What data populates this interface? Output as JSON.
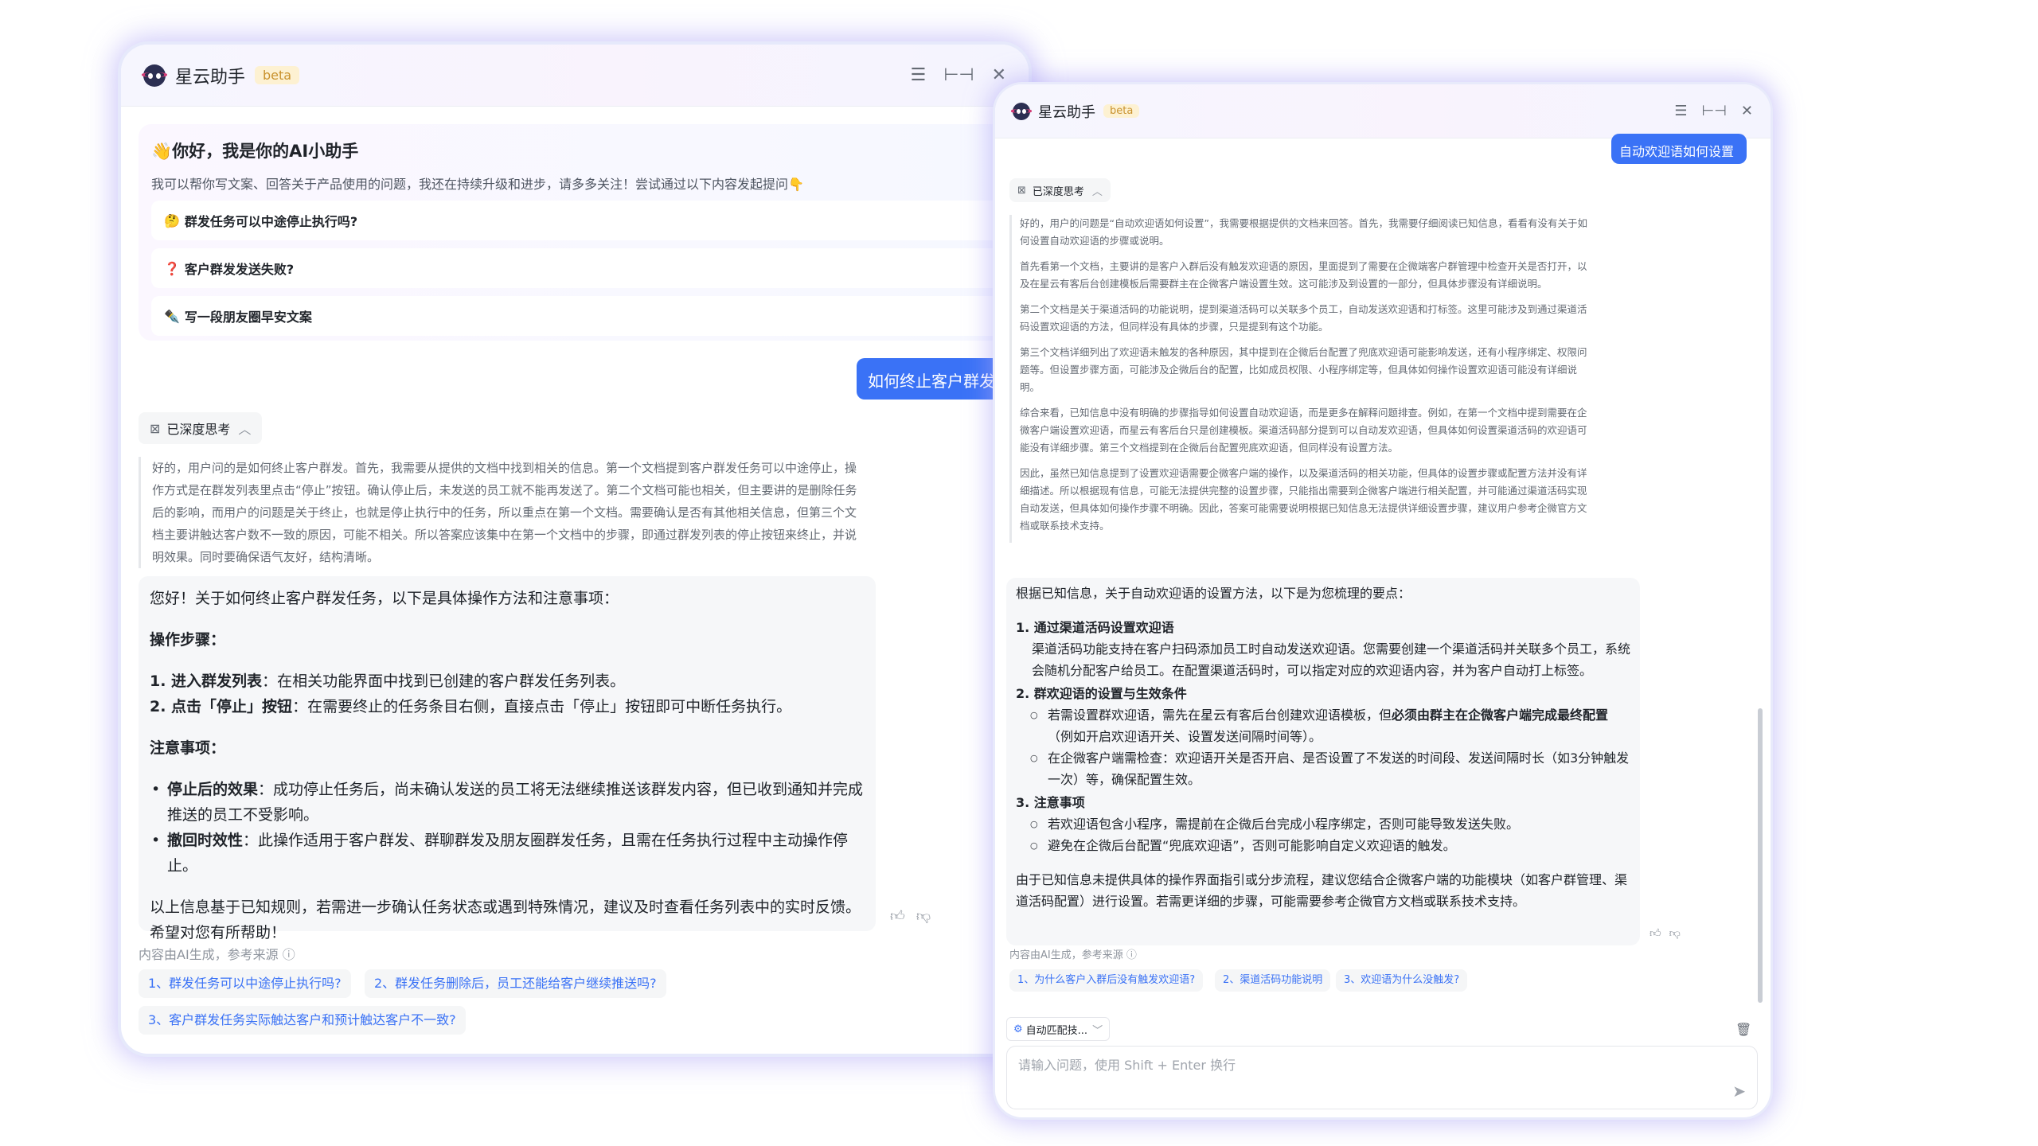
{
  "app": {
    "title": "星云助手",
    "badge": "beta"
  },
  "welcome": {
    "title": "👋你好，我是你的AI小助手",
    "desc": "我可以帮你写文案、回答关于产品使用的问题，我还在持续升级和进步，请多多关注！尝试通过以下内容发起提问👇",
    "suggestions": [
      {
        "emoji": "🤔",
        "text": "群发任务可以中途停止执行吗?"
      },
      {
        "emoji": "❓",
        "text": "客户群发发送失败?"
      },
      {
        "emoji": "✒️",
        "text": "写一段朋友圈早安文案"
      }
    ]
  },
  "chatA": {
    "user_question": "如何终止客户群发任务",
    "thinking_label": "已深度思考",
    "thinking_text": "好的，用户问的是如何终止客户群发。首先，我需要从提供的文档中找到相关的信息。第一个文档提到客户群发任务可以中途停止，操作方式是在群发列表里点击“停止”按钮。确认停止后，未发送的员工就不能再发送了。第二个文档可能也相关，但主要讲的是删除任务后的影响，而用户的问题是关于终止，也就是停止执行中的任务，所以重点在第一个文档。需要确认是否有其他相关信息，但第三个文档主要讲触达客户数不一致的原因，可能不相关。所以答案应该集中在第一个文档中的步骤，即通过群发列表的停止按钮来终止，并说明效果。同时要确保语气友好，结构清晰。",
    "answer": {
      "intro": "您好！关于如何终止客户群发任务，以下是具体操作方法和注意事项：",
      "steps_title": "操作步骤：",
      "step1_bold": "1. 进入群发列表",
      "step1_rest": "：在相关功能界面中找到已创建的客户群发任务列表。",
      "step2_bold": "2. 点击「停止」按钮",
      "step2_rest": "：在需要终止的任务条目右侧，直接点击「停止」按钮即可中断任务执行。",
      "notes_title": "注意事项：",
      "note1_bold": "停止后的效果",
      "note1_rest": "：成功停止任务后，尚未确认发送的员工将无法继续推送该群发内容，但已收到通知并完成推送的员工不受影响。",
      "note2_bold": "撤回时效性",
      "note2_rest": "：此操作适用于客户群发、群聊群发及朋友圈群发任务，且需在任务执行过程中主动操作停止。",
      "outro": "以上信息基于已知规则，若需进一步确认任务状态或遇到特殊情况，建议及时查看任务列表中的实时反馈。希望对您有所帮助！"
    },
    "source_note": "内容由AI生成，参考来源 ⓘ",
    "refs": [
      "1、群发任务可以中途停止执行吗?",
      "2、群发任务删除后，员工还能给客户继续推送吗?",
      "3、客户群发任务实际触达客户和预计触达客户不一致?"
    ]
  },
  "chatB": {
    "user_question": "自动欢迎语如何设置",
    "thinking_label": "已深度思考",
    "thinking_paras": [
      "好的，用户的问题是“自动欢迎语如何设置”，我需要根据提供的文档来回答。首先，我需要仔细阅读已知信息，看看有没有关于如何设置自动欢迎语的步骤或说明。",
      "首先看第一个文档，主要讲的是客户入群后没有触发欢迎语的原因，里面提到了需要在企微端客户群管理中检查开关是否打开，以及在星云有客后台创建模板后需要群主在企微客户端设置生效。这可能涉及到设置的一部分，但具体步骤没有详细说明。",
      "第二个文档是关于渠道活码的功能说明，提到渠道活码可以关联多个员工，自动发送欢迎语和打标签。这里可能涉及到通过渠道活码设置欢迎语的方法，但同样没有具体的步骤，只是提到有这个功能。",
      "第三个文档详细列出了欢迎语未触发的各种原因，其中提到在企微后台配置了兜底欢迎语可能影响发送，还有小程序绑定、权限问题等。但设置步骤方面，可能涉及企微后台的配置，比如成员权限、小程序绑定等，但具体如何操作设置欢迎语可能没有详细说明。",
      "综合来看，已知信息中没有明确的步骤指导如何设置自动欢迎语，而是更多在解释问题排查。例如，在第一个文档中提到需要在企微客户端设置欢迎语，而星云有客后台只是创建模板。渠道活码部分提到可以自动发欢迎语，但具体如何设置渠道活码的欢迎语可能没有详细步骤。第三个文档提到在企微后台配置兜底欢迎语，但同样没有设置方法。",
      "因此，虽然已知信息提到了设置欢迎语需要企微客户端的操作，以及渠道活码的相关功能，但具体的设置步骤或配置方法并没有详细描述。所以根据现有信息，可能无法提供完整的设置步骤，只能指出需要到企微客户端进行相关配置，并可能通过渠道活码实现自动发送，但具体如何操作步骤不明确。因此，答案可能需要说明根据已知信息无法提供详细设置步骤，建议用户参考企微官方文档或联系技术支持。"
    ],
    "answer": {
      "intro": "根据已知信息，关于自动欢迎语的设置方法，以下是为您梳理的要点：",
      "i1_title": "1. 通过渠道活码设置欢迎语",
      "i1_text": "渠道活码功能支持在客户扫码添加员工时自动发送欢迎语。您需要创建一个渠道活码并关联多个员工，系统会随机分配客户给员工。在配置渠道活码时，可以指定对应的欢迎语内容，并为客户自动打上标签。",
      "i2_title": "2. 群欢迎语的设置与生效条件",
      "i2_a_pre": "若需设置群欢迎语，需先在星云有客后台创建欢迎语模板，但",
      "i2_a_bold": "必须由群主在企微客户端完成最终配置",
      "i2_a_post": "（例如开启欢迎语开关、设置发送间隔时间等）。",
      "i2_b": "在企微客户端需检查：欢迎语开关是否开启、是否设置了不发送的时间段、发送间隔时长（如3分钟触发一次）等，确保配置生效。",
      "i3_title": "3. 注意事项",
      "i3_a": "若欢迎语包含小程序，需提前在企微后台完成小程序绑定，否则可能导致发送失败。",
      "i3_b": "避免在企微后台配置“兜底欢迎语”，否则可能影响自定义欢迎语的触发。",
      "outro": "由于已知信息未提供具体的操作界面指引或分步流程，建议您结合企微客户端的功能模块（如客户群管理、渠道活码配置）进行设置。若需更详细的步骤，可能需要参考企微官方文档或联系技术支持。"
    },
    "source_note": "内容由AI生成，参考来源 ⓘ",
    "refs": [
      "1、为什么客户入群后没有触发欢迎语?",
      "2、渠道活码功能说明",
      "3、欢迎语为什么没触发?"
    ],
    "mode_label": "自动匹配技...",
    "input_placeholder": "请输入问题，使用 Shift + Enter 换行"
  },
  "icons": [
    "robot-logo",
    "menu-icon",
    "expand-icon",
    "close-icon",
    "think-icon",
    "chevron-up-icon",
    "thumbs-up-icon",
    "thumbs-down-icon",
    "info-icon",
    "trash-icon",
    "send-icon",
    "chevron-down-icon",
    "skill-icon"
  ],
  "colors": {
    "accent": "#3a72f6",
    "beta_bg": "#fdf1d2",
    "beta_text": "#c9922e",
    "glow": "#aaa0f5"
  }
}
